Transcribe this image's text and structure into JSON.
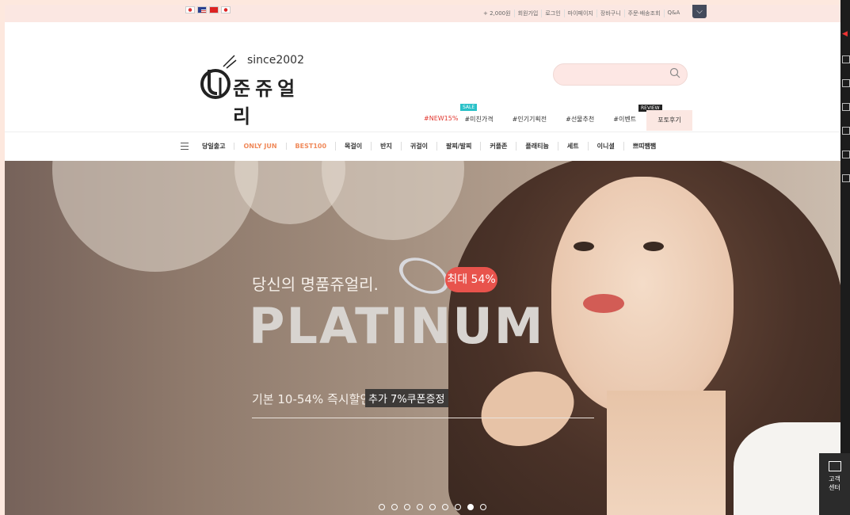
{
  "topbar": {
    "flags": [
      "flag-kr",
      "flag-us",
      "flag-cn",
      "flag-jp"
    ],
    "links": [
      "+ 2,000원",
      "회원가입",
      "로그인",
      "마이페이지",
      "장바구니",
      "주문·배송조회",
      "Q&A"
    ],
    "dropdown_icon": "chevron-down-icon"
  },
  "header": {
    "logo_since": "since2002",
    "logo_name": "준쥬얼리",
    "search_placeholder": "",
    "hash_links": [
      "#NEW15%",
      "#미친가격",
      "#인기기획전",
      "#선물추천",
      "#이벤트"
    ],
    "review_link": "포토후기",
    "badge_sale": "SALE",
    "badge_review": "REVIEW"
  },
  "menu": {
    "items": [
      "당일출고",
      "ONLY JUN",
      "BEST100",
      "목걸이",
      "반지",
      "귀걸이",
      "팔찌/발찌",
      "커플존",
      "플래티늄",
      "세트",
      "이니셜",
      "쁘띠쨈쨈"
    ]
  },
  "hero": {
    "subtitle": "당신의 명품쥬얼리.",
    "badge": "최대 54%",
    "title": "PLATINUM",
    "line": "기본 10-54% 즉시할인!",
    "tag": "추가 7%쿠폰증정",
    "slide_count": 9,
    "active_slide": 8
  },
  "sidebar": {
    "customer_center": "고객\n센터"
  },
  "colors": {
    "topbar_bg": "#fbe7e2",
    "accent_red": "#e2372f",
    "accent_orange": "#f08a5b",
    "sale_badge": "#29c1c8"
  }
}
